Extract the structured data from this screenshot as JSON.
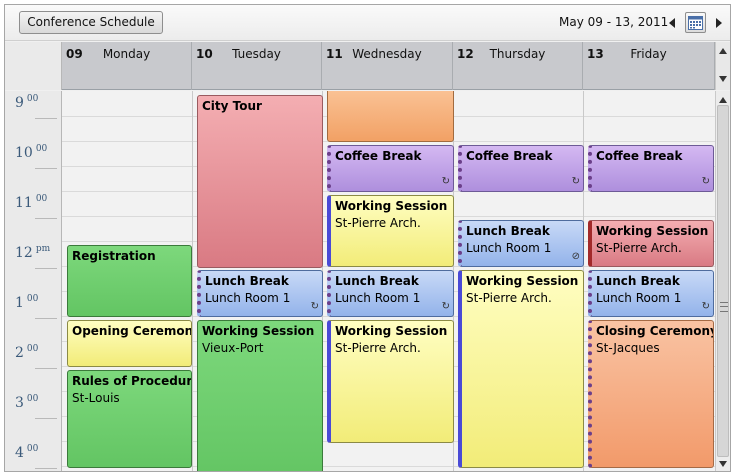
{
  "toolbar": {
    "schedule_button": "Conference Schedule",
    "date_range": "May 09 - 13, 2011",
    "calendar_icon": "calendar-icon",
    "prev_icon": "triangle-left-icon",
    "next_icon": "triangle-right-icon"
  },
  "days": [
    {
      "num": "09",
      "name": "Monday"
    },
    {
      "num": "10",
      "name": "Tuesday"
    },
    {
      "num": "11",
      "name": "Wednesday"
    },
    {
      "num": "12",
      "name": "Thursday"
    },
    {
      "num": "13",
      "name": "Friday"
    }
  ],
  "hours": [
    {
      "h": "9",
      "m": "00"
    },
    {
      "h": "10",
      "m": "00"
    },
    {
      "h": "11",
      "m": "00"
    },
    {
      "h": "12",
      "m": "pm"
    },
    {
      "h": "1",
      "m": "00"
    },
    {
      "h": "2",
      "m": "00"
    },
    {
      "h": "3",
      "m": "00"
    },
    {
      "h": "4",
      "m": "00"
    }
  ],
  "events": {
    "tue_city_tour": {
      "title": "City Tour"
    },
    "tue_lunch": {
      "title": "Lunch Break",
      "location": "Lunch Room 1"
    },
    "tue_working": {
      "title": "Working Session",
      "location": "Vieux-Port"
    },
    "mon_registration": {
      "title": "Registration"
    },
    "mon_opening": {
      "title": "Opening Ceremony"
    },
    "mon_rules": {
      "title": "Rules of Procedure",
      "location": "St-Louis"
    },
    "wed_coffee": {
      "title": "Coffee Break"
    },
    "wed_working1": {
      "title": "Working Session",
      "location": "St-Pierre Arch."
    },
    "wed_lunch": {
      "title": "Lunch Break",
      "location": "Lunch Room 1"
    },
    "wed_working2": {
      "title": "Working Session",
      "location": "St-Pierre Arch."
    },
    "thu_coffee": {
      "title": "Coffee Break"
    },
    "thu_lunch": {
      "title": "Lunch Break",
      "location": "Lunch Room 1"
    },
    "thu_working": {
      "title": "Working Session",
      "location": "St-Pierre Arch."
    },
    "fri_coffee": {
      "title": "Coffee Break"
    },
    "fri_working": {
      "title": "Working Session",
      "location": "St-Pierre Arch."
    },
    "fri_lunch": {
      "title": "Lunch Break",
      "location": "Lunch Room 1"
    },
    "fri_closing": {
      "title": "Closing Ceremony",
      "location": "St-Jacques"
    }
  },
  "recurrence_icon": "recurrence-icon",
  "colors": {
    "red": "#e8949a",
    "orange": "#f6b07d",
    "purple": "#c0a3e9",
    "yellow": "#f9f59c",
    "blue": "#aec6f0",
    "green": "#6fcf6e",
    "salmon": "#f5b085"
  }
}
